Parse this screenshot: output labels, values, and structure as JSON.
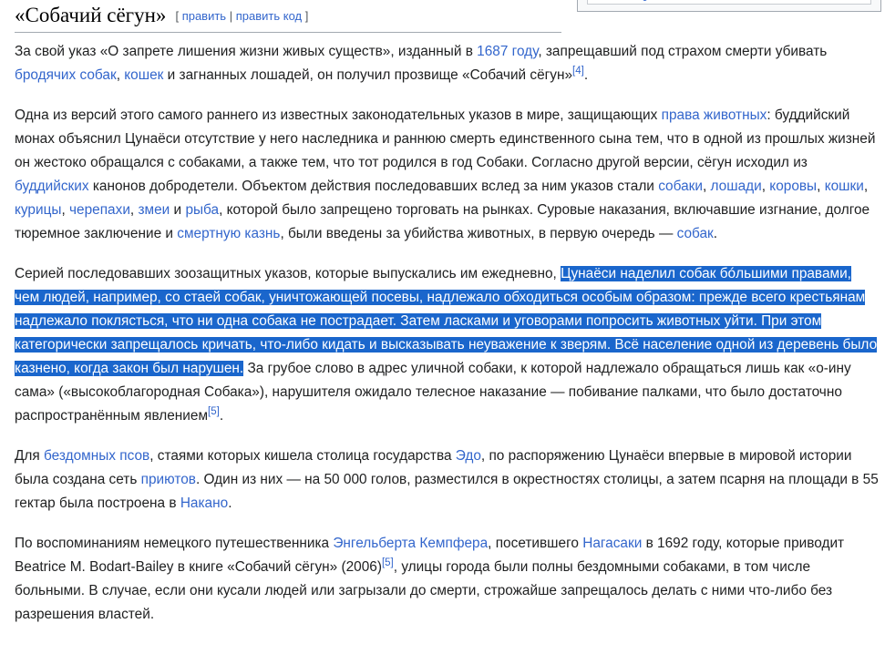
{
  "heading": {
    "title": "«Собачий сёгун»",
    "bracket_open": "[",
    "edit": "править",
    "separator": "|",
    "edit_code": "править код",
    "bracket_close": "]"
  },
  "paragraphs": {
    "p1": {
      "t1": "За свой указ «О запрете лишения жизни живых существ», изданный в ",
      "l1": "1687 году",
      "t2": ", запрещавший под страхом смерти убивать ",
      "l2": "бродячих собак",
      "t3": ", ",
      "l3": "кошек",
      "t4": " и загнанных лошадей, он получил прозвище «Собачий сёгун»",
      "ref1": "[4]",
      "t5": "."
    },
    "p2": {
      "t1": "Одна из версий этого самого раннего из известных законодательных указов в мире, защищающих ",
      "l1": "права животных",
      "t2": ": буддийский монах объяснил Цунаёси отсутствие у него наследника и раннюю смерть единственного сына тем, что в одной из прошлых жизней он жестоко обращался с собаками, а также тем, что тот родился в год Собаки. Согласно другой версии, сёгун исходил из ",
      "l2": "буддийских",
      "t3": " канонов добродетели. Объектом действия последовавших вслед за ним указов стали ",
      "l3": "собаки",
      "t4": ", ",
      "l4": "лошади",
      "t5": ", ",
      "l5": "коровы",
      "t6": ", ",
      "l6": "кошки",
      "t7": ", ",
      "l7": "курицы",
      "t8": ", ",
      "l8": "черепахи",
      "t9": ", ",
      "l9": "змеи",
      "t10": " и ",
      "l10": "рыба",
      "t11": ", которой было запрещено торговать на рынках. Суровые наказания, включавшие изгнание, долгое тюремное заключение и ",
      "l11": "смертную казнь",
      "t12": ", были введены за убийства животных, в первую очередь — ",
      "l12": "собак",
      "t13": "."
    },
    "p3": {
      "t1": "Серией последовавших зоозащитных указов, которые выпускались им ежедневно, ",
      "sel": "Цунаёси наделил собак бóльшими правами, чем людей, например, со стаей собак, уничтожающей посевы, надлежало обходиться особым образом: прежде всего крестьянам надлежало поклясться, что ни одна собака не пострадает. Затем ласками и уговорами попросить животных уйти. При этом категорически запрещалось кричать, что-либо кидать и высказывать неуважение к зверям. Всё население одной из деревень было казнено, когда закон был нарушен.",
      "t2": " За грубое слово в адрес уличной собаки, к которой надлежало обращаться лишь как «о-ину сама» («высокоблагородная Собака»), нарушителя ожидало телесное наказание — побивание палками, что было достаточно распространённым явлением",
      "ref1": "[5]",
      "t3": "."
    },
    "p4": {
      "t1": "Для ",
      "l1": "бездомных псов",
      "t2": ", стаями которых кишела столица государства ",
      "l2": "Эдо",
      "t3": ", по распоряжению Цунаёси впервые в мировой истории была создана сеть ",
      "l3": "приютов",
      "t4": ". Один из них — на 50 000 голов, разместился в окрестностях столицы, а затем псарня на площади в 55 гектар была построена в ",
      "l4": "Накано",
      "t5": "."
    },
    "p5": {
      "t1": "По воспоминаниям немецкого путешественника ",
      "l1": "Энгельберта Кемпфера",
      "t2": ", посетившего ",
      "l2": "Нагасаки",
      "t3": " в 1692 году, которые приводит Beatrice M. Bodart-Bailey в книге «Собачий сёгун» (2006)",
      "ref1": "[5]",
      "t4": ", улицы города были полны бездомными собаками, в том числе больными. В случае, если они кусали людей или загрызали до смерти, строжайше запрещалось делать с ними что-либо без разрешения властей."
    }
  },
  "colors": {
    "link": "#3366cc",
    "text": "#202122",
    "selection": "#1a66cc"
  }
}
